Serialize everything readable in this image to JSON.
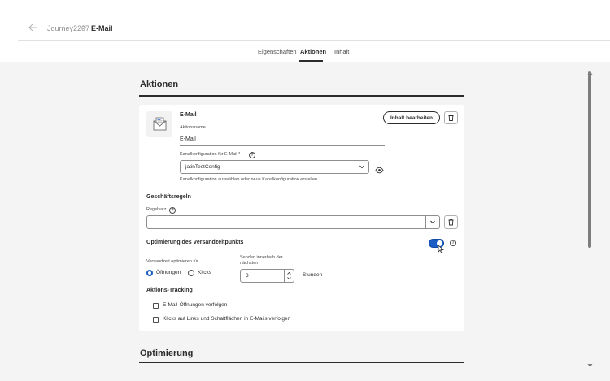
{
  "header": {
    "breadcrumb_parent": "Journey2207",
    "breadcrumb_separator": ">",
    "breadcrumb_current": "E-Mail"
  },
  "tabs": [
    {
      "label": "Eigenschaften",
      "active": false
    },
    {
      "label": "Aktionen",
      "active": true
    },
    {
      "label": "Inhalt",
      "active": false
    }
  ],
  "actions_section": {
    "title": "Aktionen"
  },
  "email_action": {
    "type_label": "E-Mail",
    "action_name_label": "Aktionsname",
    "action_name_value": "E-Mail",
    "edit_content_label": "Inhalt bearbeiten",
    "channel_config_label": "Kanalkonfiguration für E-Mail",
    "required_marker": "*",
    "channel_config_value": "jatinTestConfig",
    "channel_config_hint": "Kanalkonfiguration auswählen oder neue Kanalkonfiguration erstellen"
  },
  "business_rules": {
    "title": "Geschäftsregeln",
    "ruleset_label": "Regelsatz",
    "ruleset_value": ""
  },
  "send_time_optimization": {
    "title": "Optimierung des Versandzeitpunkts",
    "enabled": true,
    "optimize_for_label": "Versandzeit optimieren für",
    "options": [
      {
        "label": "Öffnungen",
        "selected": true
      },
      {
        "label": "Klicks",
        "selected": false
      }
    ],
    "send_within_label_line1": "Senden innerhalb der",
    "send_within_label_line2": "nächsten",
    "send_within_value": "3",
    "unit_label": "Stunden"
  },
  "action_tracking": {
    "title": "Aktions-Tracking",
    "items": [
      {
        "label": "E-Mail-Öffnungen verfolgen",
        "checked": false
      },
      {
        "label": "Klicks auf Links und Schaltflächen in E-Mails verfolgen",
        "checked": false
      }
    ]
  },
  "optimization_section": {
    "title": "Optimierung"
  },
  "colors": {
    "accent": "#1b5dc2",
    "text": "#2c2c2c",
    "background": "#f4f4f4"
  }
}
